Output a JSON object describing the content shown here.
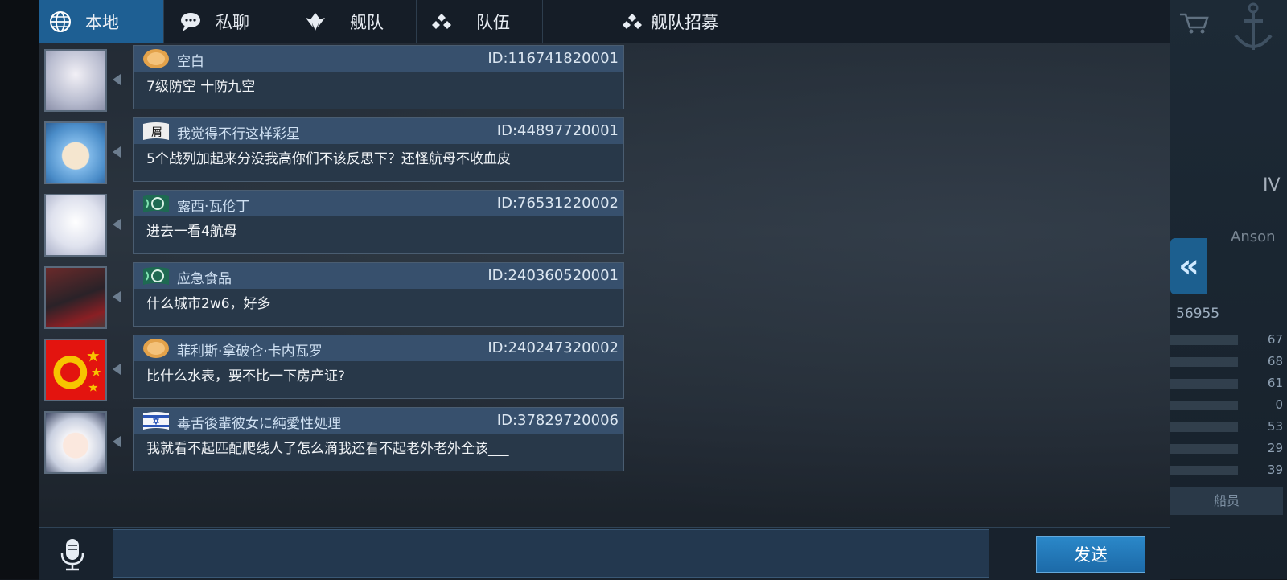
{
  "tabs": [
    {
      "label": "本地",
      "icon": "globe-icon",
      "active": true
    },
    {
      "label": "私聊",
      "icon": "speech-bubble-icon",
      "active": false
    },
    {
      "label": "舰队",
      "icon": "fleet-emblem-icon",
      "active": false
    },
    {
      "label": "队伍",
      "icon": "team-dots-icon",
      "active": false
    },
    {
      "label": "舰队招募",
      "icon": "team-dots-icon",
      "active": false
    }
  ],
  "messages": [
    {
      "name": "空白",
      "id": "ID:116741820001",
      "text": "7级防空  十防九空",
      "badge": "gold-coin-badge"
    },
    {
      "name": "我觉得不行这样彩星",
      "id": "ID:44897720001",
      "text": "5个战列加起来分没我高你们不该反思下？还怪航母不收血皮",
      "badge": "calligraphy-flag-badge"
    },
    {
      "name": "露西·瓦伦丁",
      "id": "ID:76531220002",
      "text": "进去一看4航母",
      "badge": "green-laurel-badge"
    },
    {
      "name": "应急食品",
      "id": "ID:240360520001",
      "text": "什么城市2w6，好多",
      "badge": "green-laurel-badge"
    },
    {
      "name": "菲利斯·拿破仑·卡内瓦罗",
      "id": "ID:240247320002",
      "text": "比什么水表，要不比一下房产证?",
      "badge": "gold-coin-badge"
    },
    {
      "name": "毒舌後輩彼女に純愛性処理",
      "id": "ID:37829720006",
      "text": "我就看不起匹配爬线人了怎么滴我还看不起老外老外全该___",
      "badge": "star-flag-badge"
    }
  ],
  "input": {
    "value": "",
    "placeholder": ""
  },
  "send_label": "发送",
  "background_panel": {
    "tier": "IV",
    "ship_name": "Anson",
    "power": "56955",
    "stats": [
      "67",
      "68",
      "61",
      "0",
      "53",
      "29",
      "39"
    ],
    "crew_label": "船员"
  },
  "colors": {
    "active_tab": "#1e5f93",
    "bubble_header": "#37506d",
    "send_button": "#2b88c9"
  }
}
